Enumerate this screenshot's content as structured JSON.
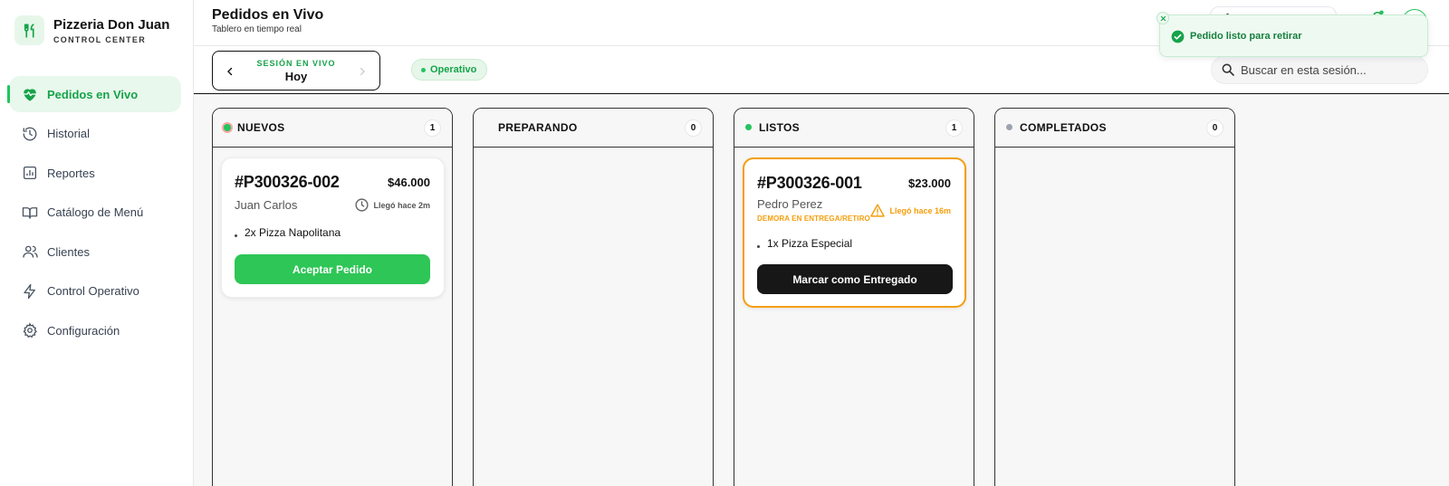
{
  "brand": {
    "name": "Pizzeria Don Juan",
    "subtitle": "CONTROL CENTER"
  },
  "sidebar": {
    "items": [
      {
        "label": "Pedidos en Vivo",
        "icon": "heart-pulse-icon",
        "active": true
      },
      {
        "label": "Historial",
        "icon": "history-icon"
      },
      {
        "label": "Reportes",
        "icon": "bar-chart-icon"
      },
      {
        "label": "Catálogo de Menú",
        "icon": "book-open-icon"
      },
      {
        "label": "Clientes",
        "icon": "users-icon"
      },
      {
        "label": "Control Operativo",
        "icon": "bolt-icon"
      },
      {
        "label": "Configuración",
        "icon": "gear-icon"
      }
    ]
  },
  "header": {
    "title": "Pedidos en Vivo",
    "subtitle": "Tablero en tiempo real"
  },
  "session": {
    "label": "SESIÓN EN VIVO",
    "value": "Hoy"
  },
  "status": {
    "label": "Operativo"
  },
  "search": {
    "placeholder": "Buscar en esta sesión..."
  },
  "toast": {
    "message": "Pedido listo para retirar"
  },
  "colors": {
    "accent": "#22c55e",
    "warning": "#f59e0b",
    "dark": "#171717"
  },
  "columns": [
    {
      "title": "NUEVOS",
      "count": "1",
      "dot": "#22c55e",
      "dot_ring": "#f87171"
    },
    {
      "title": "PREPARANDO",
      "count": "0"
    },
    {
      "title": "LISTOS",
      "count": "1",
      "dot": "#22c55e"
    },
    {
      "title": "COMPLETADOS",
      "count": "0",
      "dot": "#9ca3af"
    }
  ],
  "orders": {
    "nuevo": {
      "id": "#P300326-002",
      "total": "$46.000",
      "customer": "Juan Carlos",
      "arrived": "Llegó hace 2m",
      "item": "2x Pizza Napolitana",
      "action": "Aceptar Pedido"
    },
    "listo": {
      "id": "#P300326-001",
      "total": "$23.000",
      "customer": "Pedro Perez",
      "delay": "DEMORA EN ENTREGA/RETIRO",
      "arrived": "Llegó hace 16m",
      "item": "1x Pizza Especial",
      "action": "Marcar como Entregado"
    }
  }
}
